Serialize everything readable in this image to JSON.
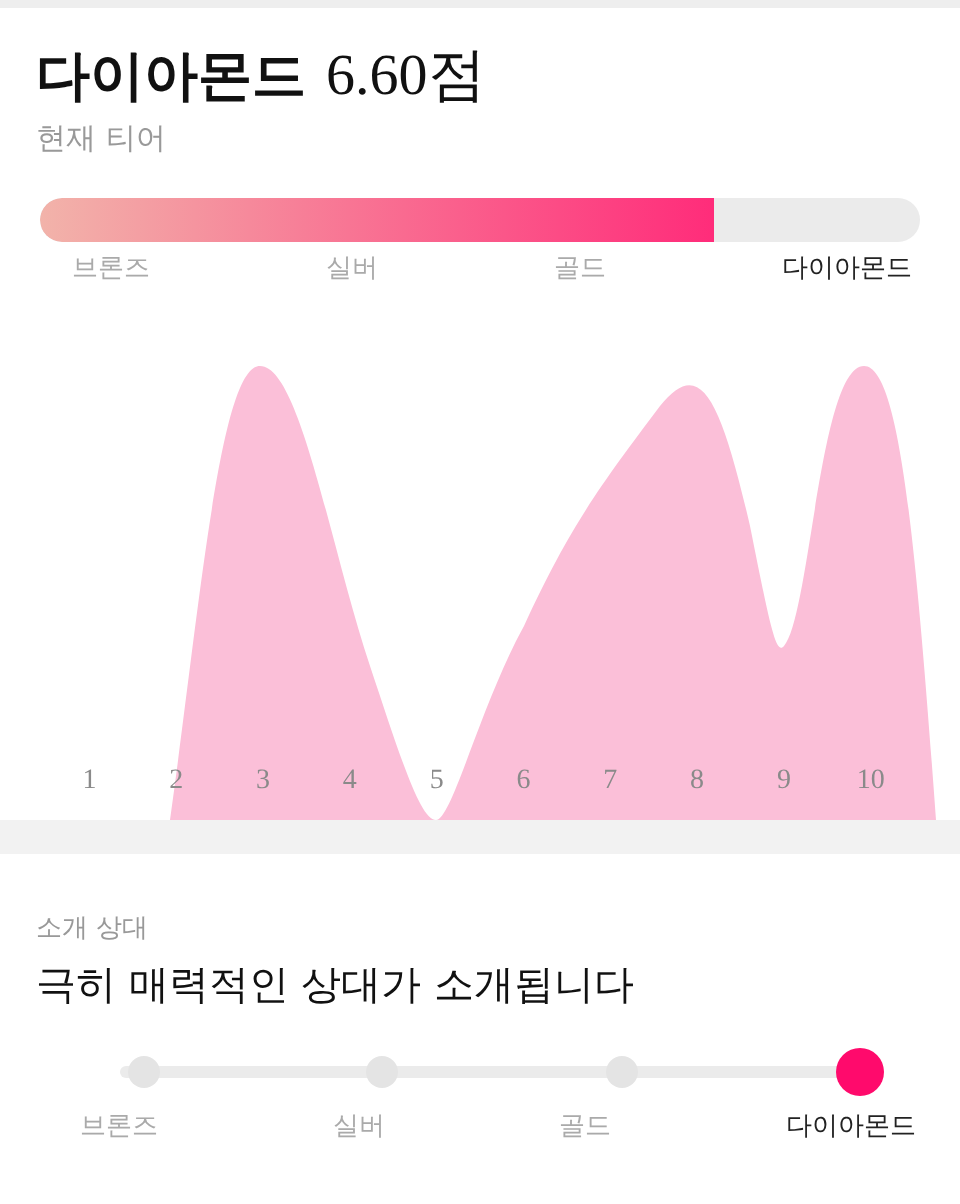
{
  "current_tier": {
    "name": "다이아몬드",
    "score": "6.60점",
    "caption": "현재 티어"
  },
  "progress": {
    "level": 0.765
  },
  "tiers": [
    {
      "label": "브론즈",
      "selected": false
    },
    {
      "label": "실버",
      "selected": false
    },
    {
      "label": "골드",
      "selected": false
    },
    {
      "label": "다이아몬드",
      "selected": true
    }
  ],
  "distribution": {
    "x_labels": [
      "1",
      "2",
      "3",
      "4",
      "5",
      "6",
      "7",
      "8",
      "9",
      "10"
    ]
  },
  "match": {
    "caption": "소개 상대",
    "description": "극히 매력적인 상대가 소개됩니다"
  },
  "match_steps": [
    {
      "label": "브론즈",
      "selected": false
    },
    {
      "label": "실버",
      "selected": false
    },
    {
      "label": "골드",
      "selected": false
    },
    {
      "label": "다이아몬드",
      "selected": true
    }
  ]
}
